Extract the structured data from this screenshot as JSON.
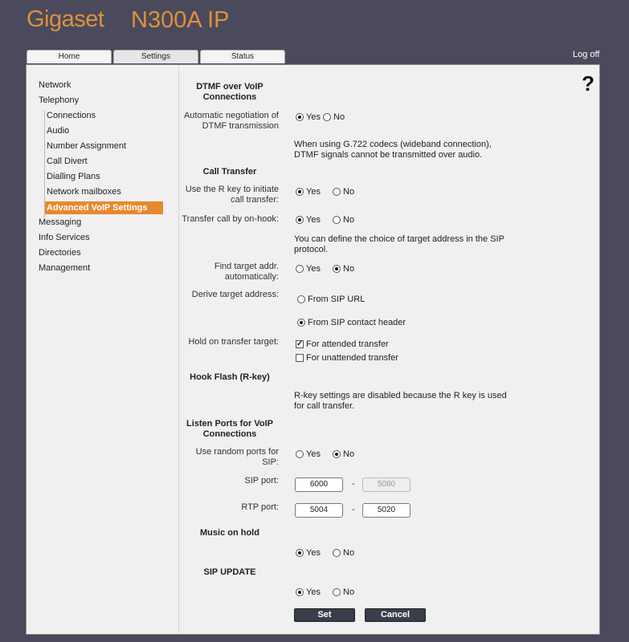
{
  "header": {
    "brand": "Gigaset",
    "model": "N300A IP",
    "logoff": "Log off"
  },
  "tabs": {
    "home": "Home",
    "settings": "Settings",
    "status": "Status"
  },
  "help": "?",
  "sidebar": {
    "network": "Network",
    "telephony": "Telephony",
    "sub": {
      "connections": "Connections",
      "audio": "Audio",
      "number_assignment": "Number Assignment",
      "call_divert": "Call Divert",
      "dialling_plans": "Dialling Plans",
      "network_mailboxes": "Network mailboxes",
      "advanced_voip": "Advanced VoIP Settings"
    },
    "messaging": "Messaging",
    "info_services": "Info Services",
    "directories": "Directories",
    "management": "Management"
  },
  "dtmf": {
    "title1": "DTMF over VoIP",
    "title2": "Connections",
    "auto_neg_label1": "Automatic negotiation of",
    "auto_neg_label2": "DTMF transmission",
    "yes": "Yes",
    "no": "No",
    "note1": "When using G.722 codecs (wideband connection),",
    "note2": "DTMF signals cannot be transmitted over audio."
  },
  "call_transfer": {
    "title": "Call Transfer",
    "r_key_label1": "Use the R key to initiate",
    "r_key_label2": "call transfer:",
    "on_hook_label": "Transfer call by on-hook:",
    "note1": "You can define the choice of target address in the SIP",
    "note2": "protocol.",
    "find_target_label1": "Find target addr.",
    "find_target_label2": "automatically:",
    "derive_label": "Derive target address:",
    "from_sip_url": "From SIP URL",
    "from_sip_contact": "From SIP contact header",
    "hold_label": "Hold on transfer target:",
    "attended": "For attended transfer",
    "unattended": "For unattended transfer",
    "yes": "Yes",
    "no": "No"
  },
  "hook_flash": {
    "title": "Hook Flash (R-key)",
    "note1": "R-key settings are disabled because the R key is used",
    "note2": "for call transfer."
  },
  "listen_ports": {
    "title1": "Listen Ports for VoIP",
    "title2": "Connections",
    "random_label1": "Use random ports for",
    "random_label2": "SIP:",
    "sip_port_label": "SIP port:",
    "sip_port_from": "6000",
    "sip_port_to": "5080",
    "rtp_port_label": "RTP port:",
    "rtp_port_from": "5004",
    "rtp_port_to": "5020",
    "dash": "-",
    "yes": "Yes",
    "no": "No"
  },
  "music_on_hold": {
    "title": "Music on hold",
    "yes": "Yes",
    "no": "No"
  },
  "sip_update": {
    "title": "SIP UPDATE",
    "yes": "Yes",
    "no": "No"
  },
  "buttons": {
    "set": "Set",
    "cancel": "Cancel"
  }
}
